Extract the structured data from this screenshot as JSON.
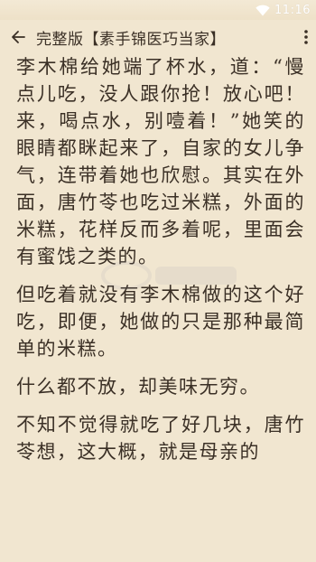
{
  "status_bar": {
    "time": "11:16",
    "wifi_icon": "wifi-icon"
  },
  "toolbar": {
    "back_icon": "arrow-left-icon",
    "title": "完整版【素手锦医巧当家】",
    "more_icon": "more-vertical-icon"
  },
  "content": {
    "paragraphs": [
      "李木棉给她端了杯水，道：“慢点儿吃，没人跟你抢！放心吧！来，喝点水，别噎着！”她笑的眼睛都眯起来了，自家的女儿争气，连带着她也欣慰。其实在外面，唐竹苓也吃过米糕，外面的米糕，花样反而多着呢，里面会有蜜饯之类的。",
      "但吃着就没有李木棉做的这个好吃，即便，她做的只是那种最简单的米糕。",
      "什么都不放，却美味无穷。",
      "不知不觉得就吃了好几块，唐竹苓想，这大概，就是母亲的"
    ]
  },
  "colors": {
    "background": "#f1e6d0",
    "text": "#3b3026",
    "status_text": "#ffffff"
  }
}
